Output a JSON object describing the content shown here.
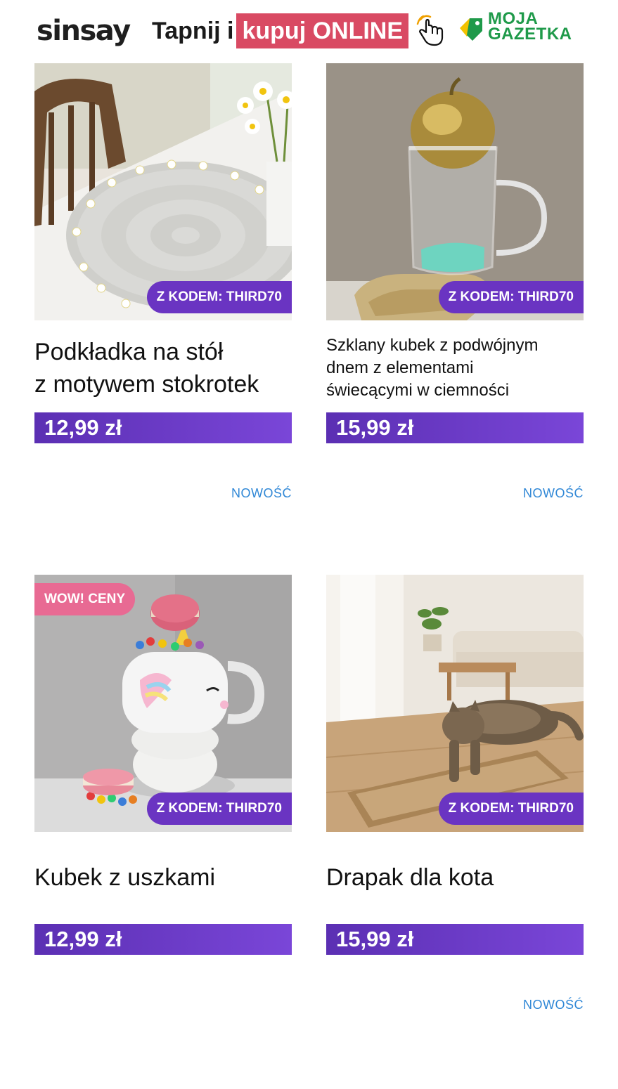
{
  "header": {
    "brand": "sinsay",
    "cta_plain": "Tapnij i",
    "cta_highlight": "kupuj ONLINE",
    "tap_icon": "hand-tap-icon",
    "partner_line1": "MOJA",
    "partner_line2": "GAZETKA",
    "brand_color": "#1f1f1f",
    "highlight_color": "#d94a63",
    "partner_color": "#1f9a4a"
  },
  "products": [
    {
      "title": "Podkładka na stół z motywem stokrotek",
      "title_line1": "Podkładka na stół",
      "title_line2": "z motywem stokrotek",
      "price": "12,99 zł",
      "code_badge": "Z KODEM: THIRD70",
      "tag": "NOWOŚĆ"
    },
    {
      "title": "Szklany kubek z podwójnym dnem z elementami świecącymi w ciemności",
      "title_line1": "Szklany kubek z podwójnym",
      "title_line2": "dnem z elementami",
      "title_line3": "świecącymi w ciemności",
      "price": "15,99 zł",
      "code_badge": "Z KODEM: THIRD70",
      "tag": "NOWOŚĆ"
    },
    {
      "title": "Kubek z uszkami",
      "price": "12,99 zł",
      "code_badge": "Z KODEM: THIRD70",
      "promo_badge": "WOW! CENY"
    },
    {
      "title": "Drapak dla kota",
      "price": "15,99 zł",
      "code_badge": "Z KODEM: THIRD70",
      "tag": "NOWOŚĆ"
    }
  ],
  "colors": {
    "price_bar": "#6a34c2",
    "tag": "#2f87d6",
    "promo_badge": "#e86a93"
  }
}
